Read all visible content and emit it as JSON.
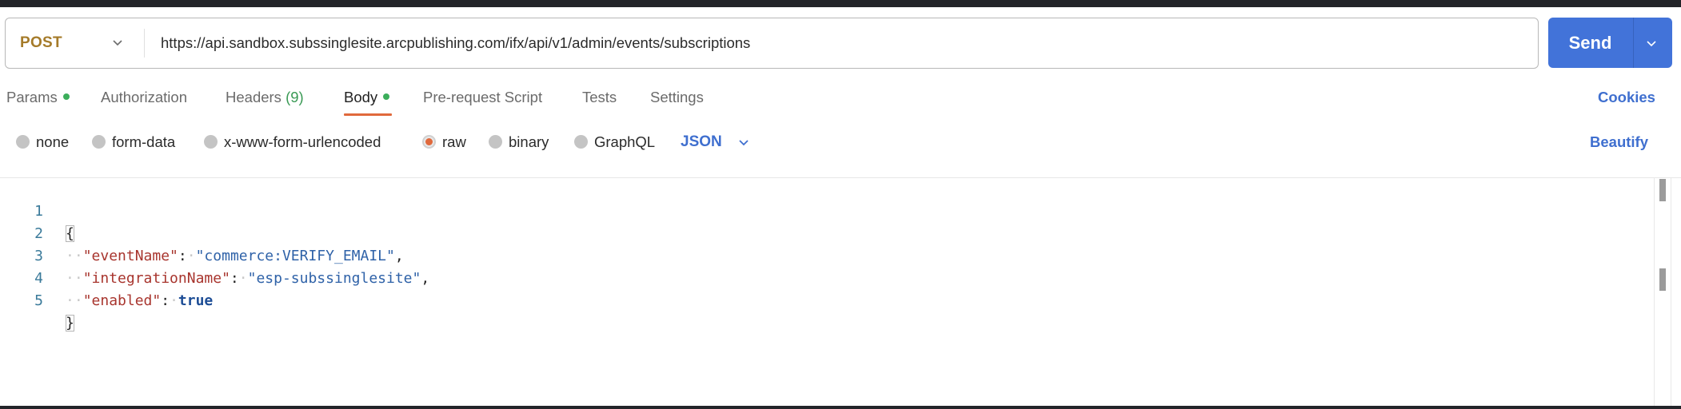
{
  "request": {
    "method": "POST",
    "url": "https://api.sandbox.subssinglesite.arcpublishing.com/ifx/api/v1/admin/events/subscriptions",
    "method_color": "#a57b2a",
    "send_label": "Send",
    "send_color": "#4273d9"
  },
  "tabs": [
    {
      "label": "Params",
      "dot": true
    },
    {
      "label": "Authorization"
    },
    {
      "label": "Headers",
      "count": "(9)"
    },
    {
      "label": "Body",
      "dot": true,
      "active": true
    },
    {
      "label": "Pre-request Script"
    },
    {
      "label": "Tests"
    },
    {
      "label": "Settings"
    }
  ],
  "cookies_label": "Cookies",
  "body_types": [
    {
      "label": "none",
      "selected": false
    },
    {
      "label": "form-data",
      "selected": false
    },
    {
      "label": "x-www-form-urlencoded",
      "selected": false
    },
    {
      "label": "raw",
      "selected": true
    },
    {
      "label": "binary",
      "selected": false
    },
    {
      "label": "GraphQL",
      "selected": false
    }
  ],
  "body_language": "JSON",
  "beautify_label": "Beautify",
  "editor": {
    "line_numbers": [
      "1",
      "2",
      "3",
      "4",
      "5"
    ],
    "lines": {
      "open_brace": "{",
      "l2_key": "\"eventName\"",
      "l2_value": "\"commerce:VERIFY_EMAIL\"",
      "l3_key": "\"integrationName\"",
      "l3_value": "\"esp-subssinglesite\"",
      "l4_key": "\"enabled\"",
      "l4_value": "true",
      "close_brace": "}"
    },
    "colon": ":",
    "comma": ",",
    "indent_marker": "··",
    "space_marker": "·"
  },
  "colors": {
    "accent_blue": "#3f6fcf",
    "active_tab_underline": "#e0693c",
    "status_dot": "#3cae5b"
  }
}
